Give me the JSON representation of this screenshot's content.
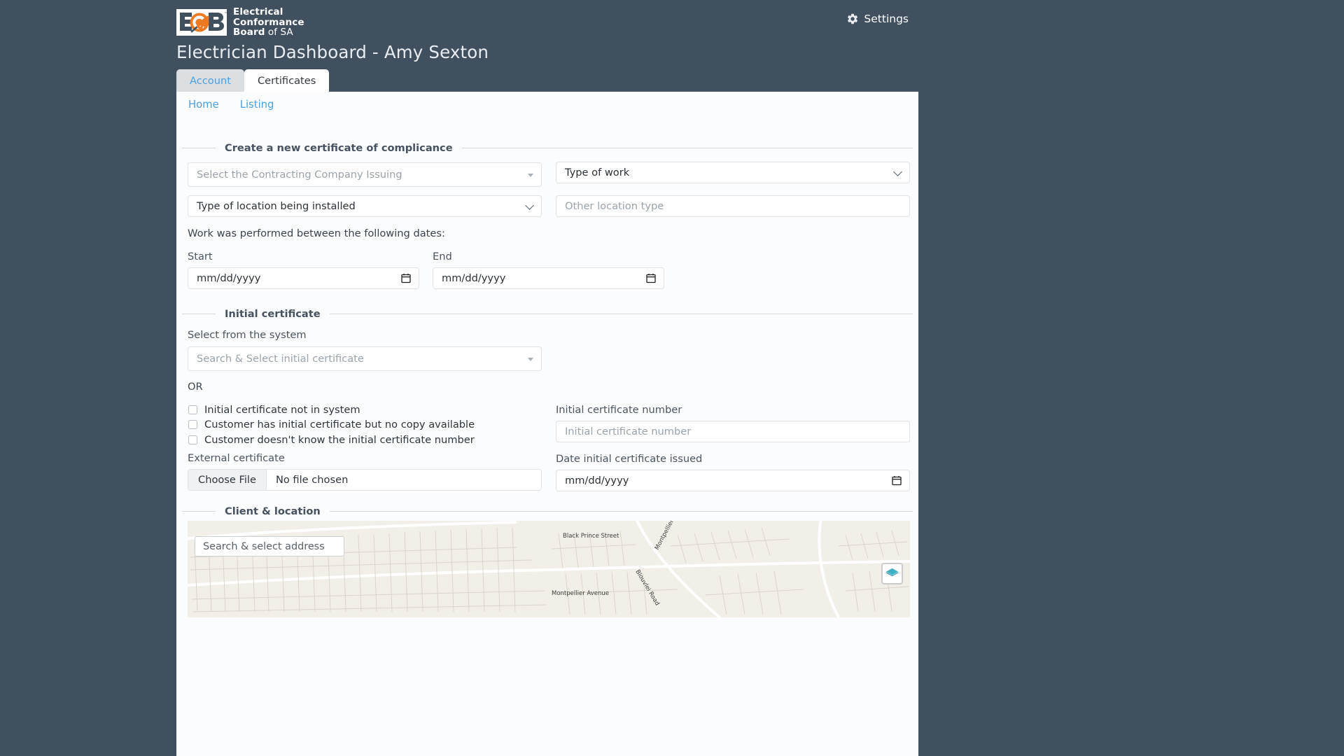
{
  "brand": {
    "logo_letters": "ECB",
    "line1": "Electrical",
    "line2": "Conformance",
    "line3": "Board",
    "line3_suffix": " of SA",
    "orange": "#ED7A23",
    "header_bg": "#41505f"
  },
  "header": {
    "settings_label": "Settings",
    "settings_icon": "gear-icon",
    "page_title": "Electrician Dashboard - Amy Sexton"
  },
  "tabs": [
    {
      "label": "Account",
      "active": false
    },
    {
      "label": "Certificates",
      "active": true
    }
  ],
  "subnav": [
    {
      "label": "Home"
    },
    {
      "label": "Listing"
    }
  ],
  "sections": {
    "create": {
      "legend": "Create a new certificate of complicance"
    },
    "initial": {
      "legend": "Initial certificate"
    },
    "client": {
      "legend": "Client & location"
    }
  },
  "form": {
    "contracting_company": {
      "placeholder": "Select the Contracting Company Issuing",
      "value": "",
      "icon": "caret-down-icon"
    },
    "type_of_work": {
      "value": "Type of work",
      "icon": "chevron-down-icon"
    },
    "type_of_location": {
      "value": "Type of location being installed",
      "icon": "chevron-down-icon"
    },
    "other_location_type": {
      "placeholder": "Other location type",
      "value": ""
    },
    "dates_note": "Work was performed between the following dates:",
    "start_label": "Start",
    "start_date": {
      "placeholder": "mm/dd/yyyy",
      "value": "",
      "icon": "calendar-icon"
    },
    "end_label": "End",
    "end_date": {
      "placeholder": "mm/dd/yyyy",
      "value": "",
      "icon": "calendar-icon"
    },
    "select_from_system_label": "Select from the system",
    "initial_cert_search": {
      "placeholder": "Search & Select initial certificate",
      "value": "",
      "icon": "caret-down-icon"
    },
    "or_label": "OR",
    "checkboxes": [
      {
        "label": "Initial certificate not in system",
        "checked": false
      },
      {
        "label": "Customer has initial certificate but no copy available",
        "checked": false
      },
      {
        "label": "Customer doesn't know the initial certificate number",
        "checked": false
      }
    ],
    "initial_cert_number_label": "Initial certificate number",
    "initial_cert_number": {
      "placeholder": "Initial certificate number",
      "value": ""
    },
    "external_certificate_label": "External certificate",
    "file_input": {
      "button_label": "Choose File",
      "status": "No file chosen"
    },
    "date_issued_label": "Date initial certificate issued",
    "date_issued": {
      "placeholder": "mm/dd/yyyy",
      "value": "",
      "icon": "calendar-icon"
    }
  },
  "map": {
    "search_placeholder": "Search & select address",
    "layers_icon": "layers-icon",
    "street_labels": [
      "Black Prince Street",
      "Montpellier Avenue",
      "Montpellier Avenue",
      "Blouvlei Road"
    ],
    "background": "#f2efe9"
  }
}
